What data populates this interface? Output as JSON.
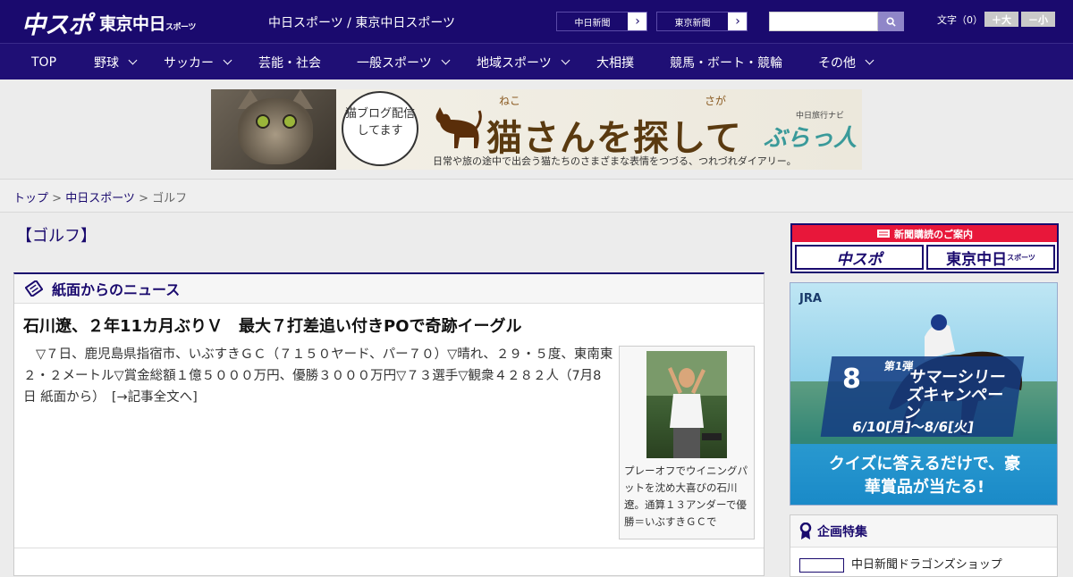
{
  "header": {
    "logo_main": "中スポ",
    "logo_sub": "東京中日",
    "logo_sub_small": "スポーツ",
    "site_title": "中日スポーツ / 東京中日スポーツ",
    "paper_links": [
      {
        "label": "中日新聞",
        "arrow": "›"
      },
      {
        "label": "東京新聞",
        "arrow": "›"
      }
    ],
    "search": {
      "placeholder": ""
    },
    "font_size_label": "文字（0）",
    "font_size_up": "＋大",
    "font_size_down": "－小"
  },
  "nav": {
    "items": [
      {
        "label": "TOP",
        "dropdown": false
      },
      {
        "label": "野球",
        "dropdown": true
      },
      {
        "label": "サッカー",
        "dropdown": true
      },
      {
        "label": "芸能・社会",
        "dropdown": false
      },
      {
        "label": "一般スポーツ",
        "dropdown": true
      },
      {
        "label": "地域スポーツ",
        "dropdown": true
      },
      {
        "label": "大相撲",
        "dropdown": false
      },
      {
        "label": "競馬・ボート・競輪",
        "dropdown": false
      },
      {
        "label": "その他",
        "dropdown": true
      }
    ]
  },
  "banner": {
    "bubble": "猫ブログ配信してます",
    "ruby_1": "ねこ",
    "ruby_2": "さが",
    "title": "猫さんを探して",
    "brand_small": "中日旅行ナビ",
    "brand": "ぶらっ人",
    "subtitle": "日常や旅の途中で出会う猫たちのさまざまな表情をつづる、つれづれダイアリー。"
  },
  "breadcrumb": {
    "home": "トップ",
    "sep1": " > ",
    "section": "中日スポーツ",
    "sep2": " > ",
    "current": "ゴルフ"
  },
  "page_title": "【ゴルフ】",
  "news": {
    "section_title": "紙面からのニュース",
    "headline": "石川遼、２年11カ月ぶりＶ　最大７打差追い付きPOで奇跡イーグル",
    "body": "▽７日、鹿児島県指宿市、いぶすきＧＣ（７１５０ヤード、パー７０）▽晴れ、２９・５度、東南東２・２メートル▽賞金総額１億５０００万円、優勝３０００万円▽７３選手▽観衆４２８２人（7月8日 紙面から）",
    "more_link": "[→記事全文へ]",
    "photo_caption": "プレーオフでウイニングパットを沈め大喜びの石川遼。通算１３アンダーで優勝＝いぶすきＧＣで"
  },
  "sidebar": {
    "subscription": {
      "header": "新聞購読のご案内",
      "btn_1": "中スポ",
      "btn_2": "東京中日",
      "btn_2_small": "スポーツ"
    },
    "ad": {
      "logo": "JRA",
      "round": "第1弾",
      "campaign": "サマーシリーズキャンペーン",
      "dates": "6/10[月]～8/6[火]",
      "number": "8",
      "cta": "クイズに答えるだけで、豪華賞品が当たる!"
    },
    "feature": {
      "title": "企画特集",
      "item": "中日新聞ドラゴンズショップ"
    }
  },
  "colors": {
    "brand_navy": "#1a0a6e",
    "accent_red": "#e8173a"
  }
}
